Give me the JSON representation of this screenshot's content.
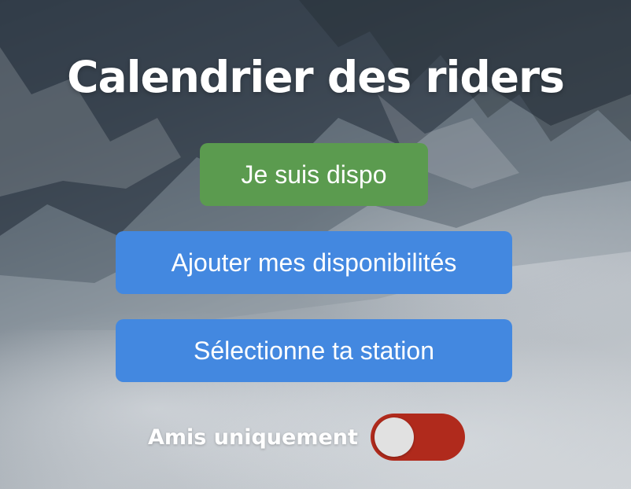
{
  "page": {
    "title": "Calendrier des riders"
  },
  "actions": {
    "dispo_label": "Je suis dispo",
    "add_availability_label": "Ajouter mes disponibilités",
    "select_station_label": "Sélectionne ta station"
  },
  "filters": {
    "friends_only_label": "Amis uniquement",
    "friends_only_enabled": false
  },
  "colors": {
    "dispo_button": "#5b9b4f",
    "primary_button": "#4388e0",
    "toggle_off_track": "#b02a1c",
    "toggle_knob": "#e1e1e1",
    "text": "#ffffff"
  },
  "background": {
    "image": "snowy-mountain-with-clouds"
  }
}
